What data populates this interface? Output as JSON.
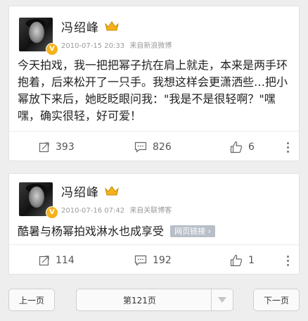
{
  "posts": [
    {
      "author": "冯绍峰",
      "time": "2010-07-15 20:33",
      "source": "来自新浪微博",
      "text": "今天拍戏，我一把把幂子抗在肩上就走，本来是两手环抱着，后来松开了一只手。我想这样会更潇洒些…把小幂放下来后，她眨眨眼问我：\"我是不是很轻啊？\"嘿嘿，确实很轻，好可爱！",
      "reposts": "393",
      "comments": "826",
      "likes": "6"
    },
    {
      "author": "冯绍峰",
      "time": "2010-07-16 07:42",
      "source": "来自关联博客",
      "text": "酷暑与杨幂拍戏淋水也成享受",
      "link_label": "网页链接",
      "reposts": "114",
      "comments": "192",
      "likes": "1"
    }
  ],
  "pager": {
    "prev": "上一页",
    "current": "第121页",
    "next": "下一页"
  },
  "icons": {
    "verified": "v-badge-icon",
    "vip": "crown-icon",
    "repost": "repost-icon",
    "comment": "comment-icon",
    "like": "thumb-up-icon",
    "more": "more-dots-icon"
  },
  "colors": {
    "vip_gold": "#f5b21b",
    "link_tag": "#b8bfc9"
  }
}
